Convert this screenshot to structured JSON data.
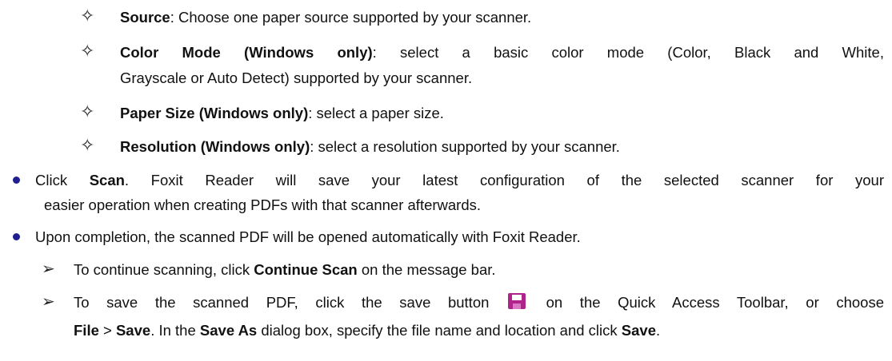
{
  "sub_items": [
    {
      "term": "Source",
      "text": ": Choose one paper source supported by your scanner."
    },
    {
      "term": "Color Mode (Windows only)",
      "text_1": ": select a basic color mode (Color, Black and White,",
      "text_2": "Grayscale or Auto Detect) supported by your scanner."
    },
    {
      "term": "Paper Size (Windows only)",
      "text": ": select a paper size."
    },
    {
      "term": "Resolution (Windows only)",
      "text": ": select a resolution supported by your scanner."
    }
  ],
  "bullets": [
    {
      "pre": "Click ",
      "bold": "Scan",
      "post": ". Foxit Reader will save your latest configuration of the selected scanner for your",
      "line2": "easier operation when creating PDFs with that scanner afterwards."
    },
    {
      "text": "Upon completion, the scanned PDF will be opened automatically with Foxit Reader."
    }
  ],
  "arrows": [
    {
      "pre": "To continue scanning, click ",
      "bold": "Continue Scan",
      "post": " on the message bar."
    },
    {
      "line1_pre": "To save the scanned PDF, click the save button ",
      "line1_post": " on the Quick Access Toolbar, or choose",
      "line2": {
        "b1": "File",
        "t1": " > ",
        "b2": "Save",
        "t2": ". In the ",
        "b3": "Save As",
        "t3": " dialog box, specify the file name and location and click ",
        "b4": "Save",
        "t4": "."
      }
    }
  ],
  "icons": {
    "sub_marker": "four-point-star-icon",
    "bullet_marker": "bullet-dot-icon",
    "arrow_marker": "arrow-marker-icon",
    "save": "save-icon"
  },
  "colors": {
    "bullet": "#1f1f8f",
    "save_icon": "#b0238a"
  }
}
